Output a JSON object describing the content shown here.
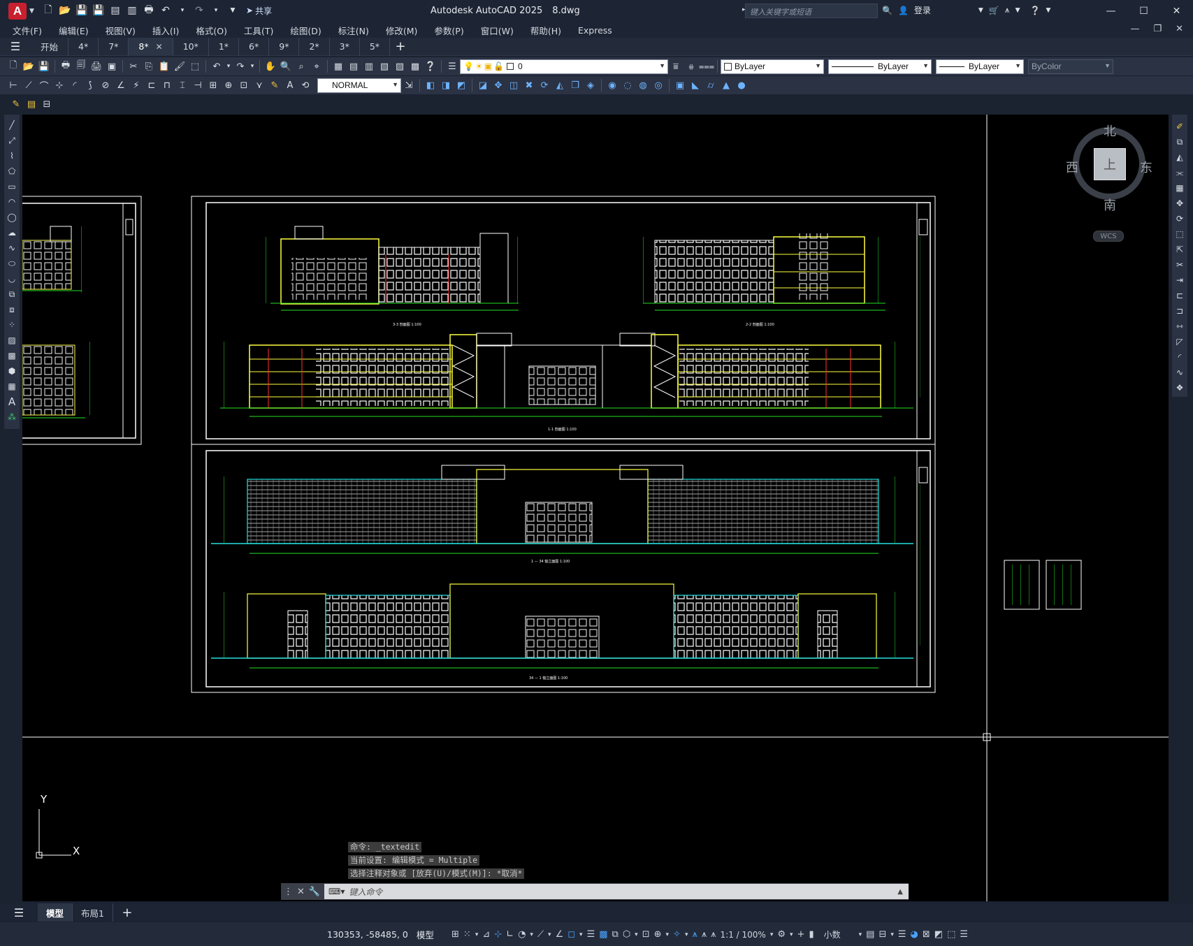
{
  "app": {
    "logo": "A",
    "title": "Autodesk AutoCAD 2025",
    "file": "8.dwg"
  },
  "search": {
    "placeholder": "键入关键字或短语"
  },
  "account": {
    "login": "登录",
    "share": "共享"
  },
  "menu": [
    "文件(F)",
    "编辑(E)",
    "视图(V)",
    "插入(I)",
    "格式(O)",
    "工具(T)",
    "绘图(D)",
    "标注(N)",
    "修改(M)",
    "参数(P)",
    "窗口(W)",
    "帮助(H)",
    "Express"
  ],
  "tabs": [
    {
      "label": "开始"
    },
    {
      "label": "4*"
    },
    {
      "label": "7*"
    },
    {
      "label": "8*",
      "active": true
    },
    {
      "label": "10*"
    },
    {
      "label": "1*"
    },
    {
      "label": "6*"
    },
    {
      "label": "9*"
    },
    {
      "label": "2*"
    },
    {
      "label": "3*"
    },
    {
      "label": "5*"
    }
  ],
  "toolbar": {
    "layer_value": "0",
    "color": "ByLayer",
    "linetype": "ByLayer",
    "lineweight": "ByLayer",
    "plotstyle": "ByColor",
    "dimstyle": "NORMAL"
  },
  "viewcube": {
    "north": "北",
    "south": "南",
    "east": "东",
    "west": "西",
    "face": "上",
    "wcs": "WCS"
  },
  "axes": {
    "y": "Y",
    "x": "X"
  },
  "drawing_labels": {
    "s1": "3-3 剖面图 1:100",
    "s2": "2-2 剖面图 1:100",
    "s3": "1-1 剖面图 1:100",
    "e1": "1 — 34 轴立面图 1:100",
    "e2": "34 — 1 轴立面图 1:100"
  },
  "command_history": [
    "命令: _textedit",
    "当前设置: 编辑模式 = Multiple",
    "选择注释对象或 [放弃(U)/模式(M)]: *取消*"
  ],
  "command": {
    "placeholder": "键入命令"
  },
  "layout_tabs": [
    {
      "label": "模型",
      "active": true
    },
    {
      "label": "布局1"
    }
  ],
  "status": {
    "coords": "130353, -58485, 0",
    "space": "模型",
    "scale": "1:1 / 100%",
    "units": "小数"
  },
  "colors": {
    "accent": "#4aa3ff",
    "logo": "#c8202f",
    "canvas": "#000000"
  }
}
